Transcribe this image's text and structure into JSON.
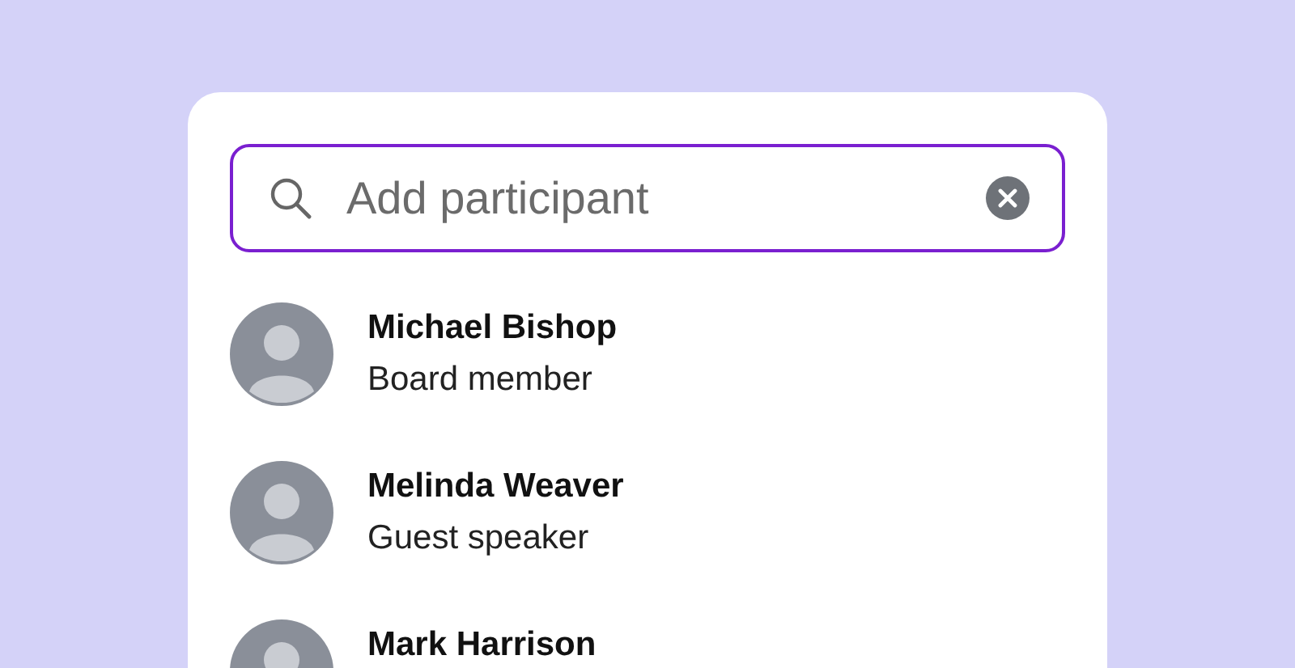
{
  "search": {
    "placeholder": "Add participant"
  },
  "participants": [
    {
      "name": "Michael Bishop",
      "role": "Board member"
    },
    {
      "name": "Melinda Weaver",
      "role": "Guest speaker"
    },
    {
      "name": "Mark Harrison"
    }
  ]
}
